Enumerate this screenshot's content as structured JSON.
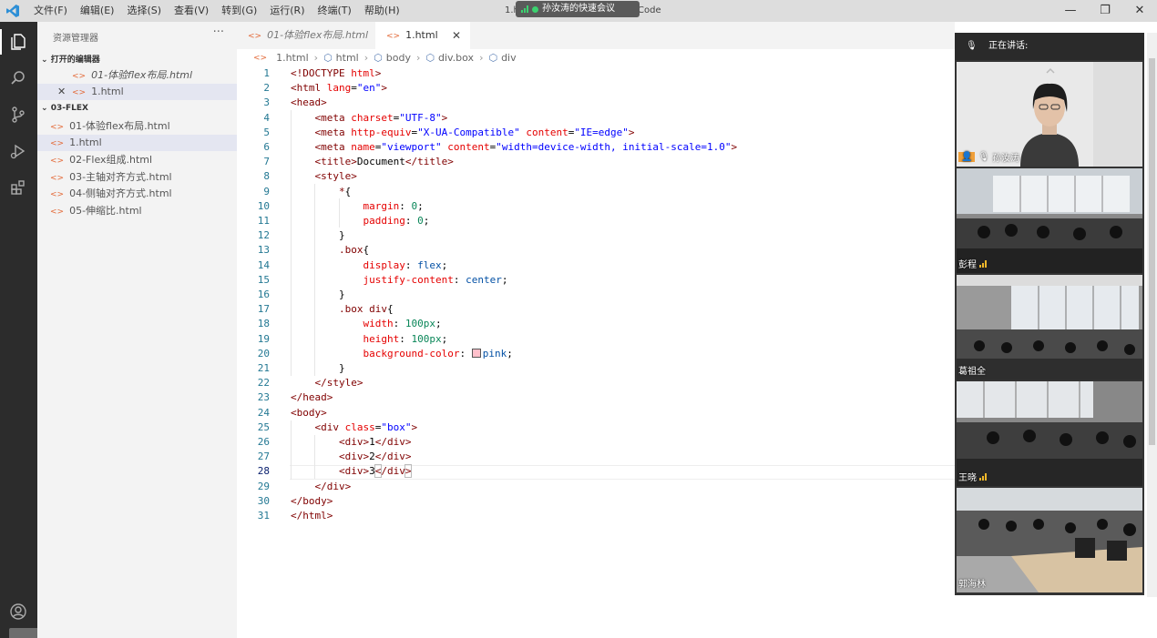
{
  "titlebar": {
    "menu": [
      "文件(F)",
      "编辑(E)",
      "选择(S)",
      "查看(V)",
      "转到(G)",
      "运行(R)",
      "终端(T)",
      "帮助(H)"
    ],
    "window_title_left": "1.html",
    "window_title_right": "Code",
    "meeting_banner": "孙汝涛的快速会议"
  },
  "sidebar": {
    "title": "资源管理器",
    "more": "···",
    "open_editors_title": "打开的编辑器",
    "open_editors": [
      "01-体验flex布局.html",
      "1.html"
    ],
    "folder_title": "03-FLEX",
    "files": [
      "01-体验flex布局.html",
      "1.html",
      "02-Flex组成.html",
      "03-主轴对齐方式.html",
      "04-侧轴对齐方式.html",
      "05-伸缩比.html"
    ]
  },
  "tabs": [
    {
      "label": "01-体验flex布局.html",
      "active": false
    },
    {
      "label": "1.html",
      "active": true
    }
  ],
  "breadcrumb": [
    "1.html",
    "html",
    "body",
    "div.box",
    "div"
  ],
  "editor": {
    "current_line": 28,
    "line_numbers": [
      "1",
      "2",
      "3",
      "4",
      "5",
      "6",
      "7",
      "8",
      "9",
      "10",
      "11",
      "12",
      "13",
      "14",
      "15",
      "16",
      "17",
      "18",
      "19",
      "20",
      "21",
      "22",
      "23",
      "24",
      "25",
      "26",
      "27",
      "28",
      "29",
      "30",
      "31"
    ]
  },
  "meeting": {
    "speaking_label": "正在讲话:",
    "participants": [
      "孙汝涛",
      "彭程",
      "葛祖全",
      "王晓",
      "郭海林"
    ]
  }
}
